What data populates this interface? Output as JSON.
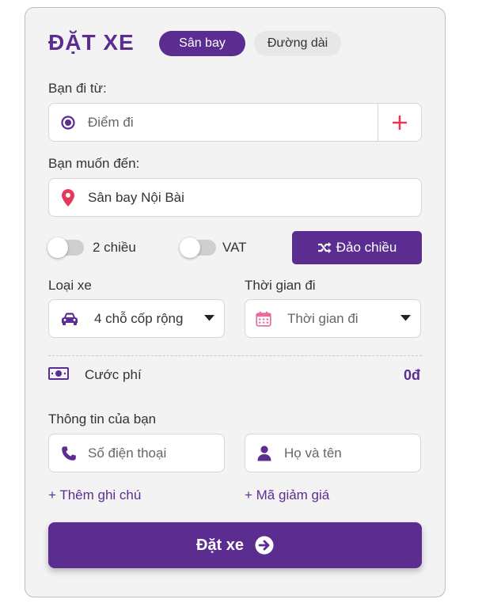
{
  "header": {
    "title": "ĐẶT XE",
    "tabs": [
      {
        "label": "Sân bay",
        "active": true
      },
      {
        "label": "Đường dài",
        "active": false
      }
    ]
  },
  "origin": {
    "label": "Bạn đi từ:",
    "placeholder": "Điểm đi",
    "icon": "radio-dot-icon",
    "add_icon": "plus-icon"
  },
  "destination": {
    "label": "Bạn muốn đến:",
    "value": "Sân bay Nội Bài",
    "icon": "map-pin-icon"
  },
  "options": {
    "round_trip_label": "2 chiều",
    "round_trip_on": false,
    "vat_label": "VAT",
    "vat_on": false,
    "swap_label": "Đảo chiều",
    "swap_icon": "shuffle-icon"
  },
  "vehicle": {
    "label": "Loại xe",
    "value": "4 chỗ cốp rộng",
    "icon": "car-icon"
  },
  "time": {
    "label": "Thời gian đi",
    "placeholder": "Thời gian đi",
    "icon": "calendar-icon"
  },
  "fare": {
    "label": "Cước phí",
    "value": "0đ",
    "icon": "money-icon"
  },
  "contact": {
    "label": "Thông tin của bạn",
    "phone_placeholder": "Số điện thoại",
    "name_placeholder": "Họ và tên"
  },
  "links": {
    "note": "+ Thêm ghi chú",
    "promo": "+ Mã giảm giá"
  },
  "submit": {
    "label": "Đặt xe",
    "icon": "arrow-circle-right-icon"
  },
  "colors": {
    "primary": "#5c2d91",
    "accent_red": "#e8385a",
    "calendar_pink": "#e56b9d",
    "card_bg": "#f3f3f4"
  }
}
